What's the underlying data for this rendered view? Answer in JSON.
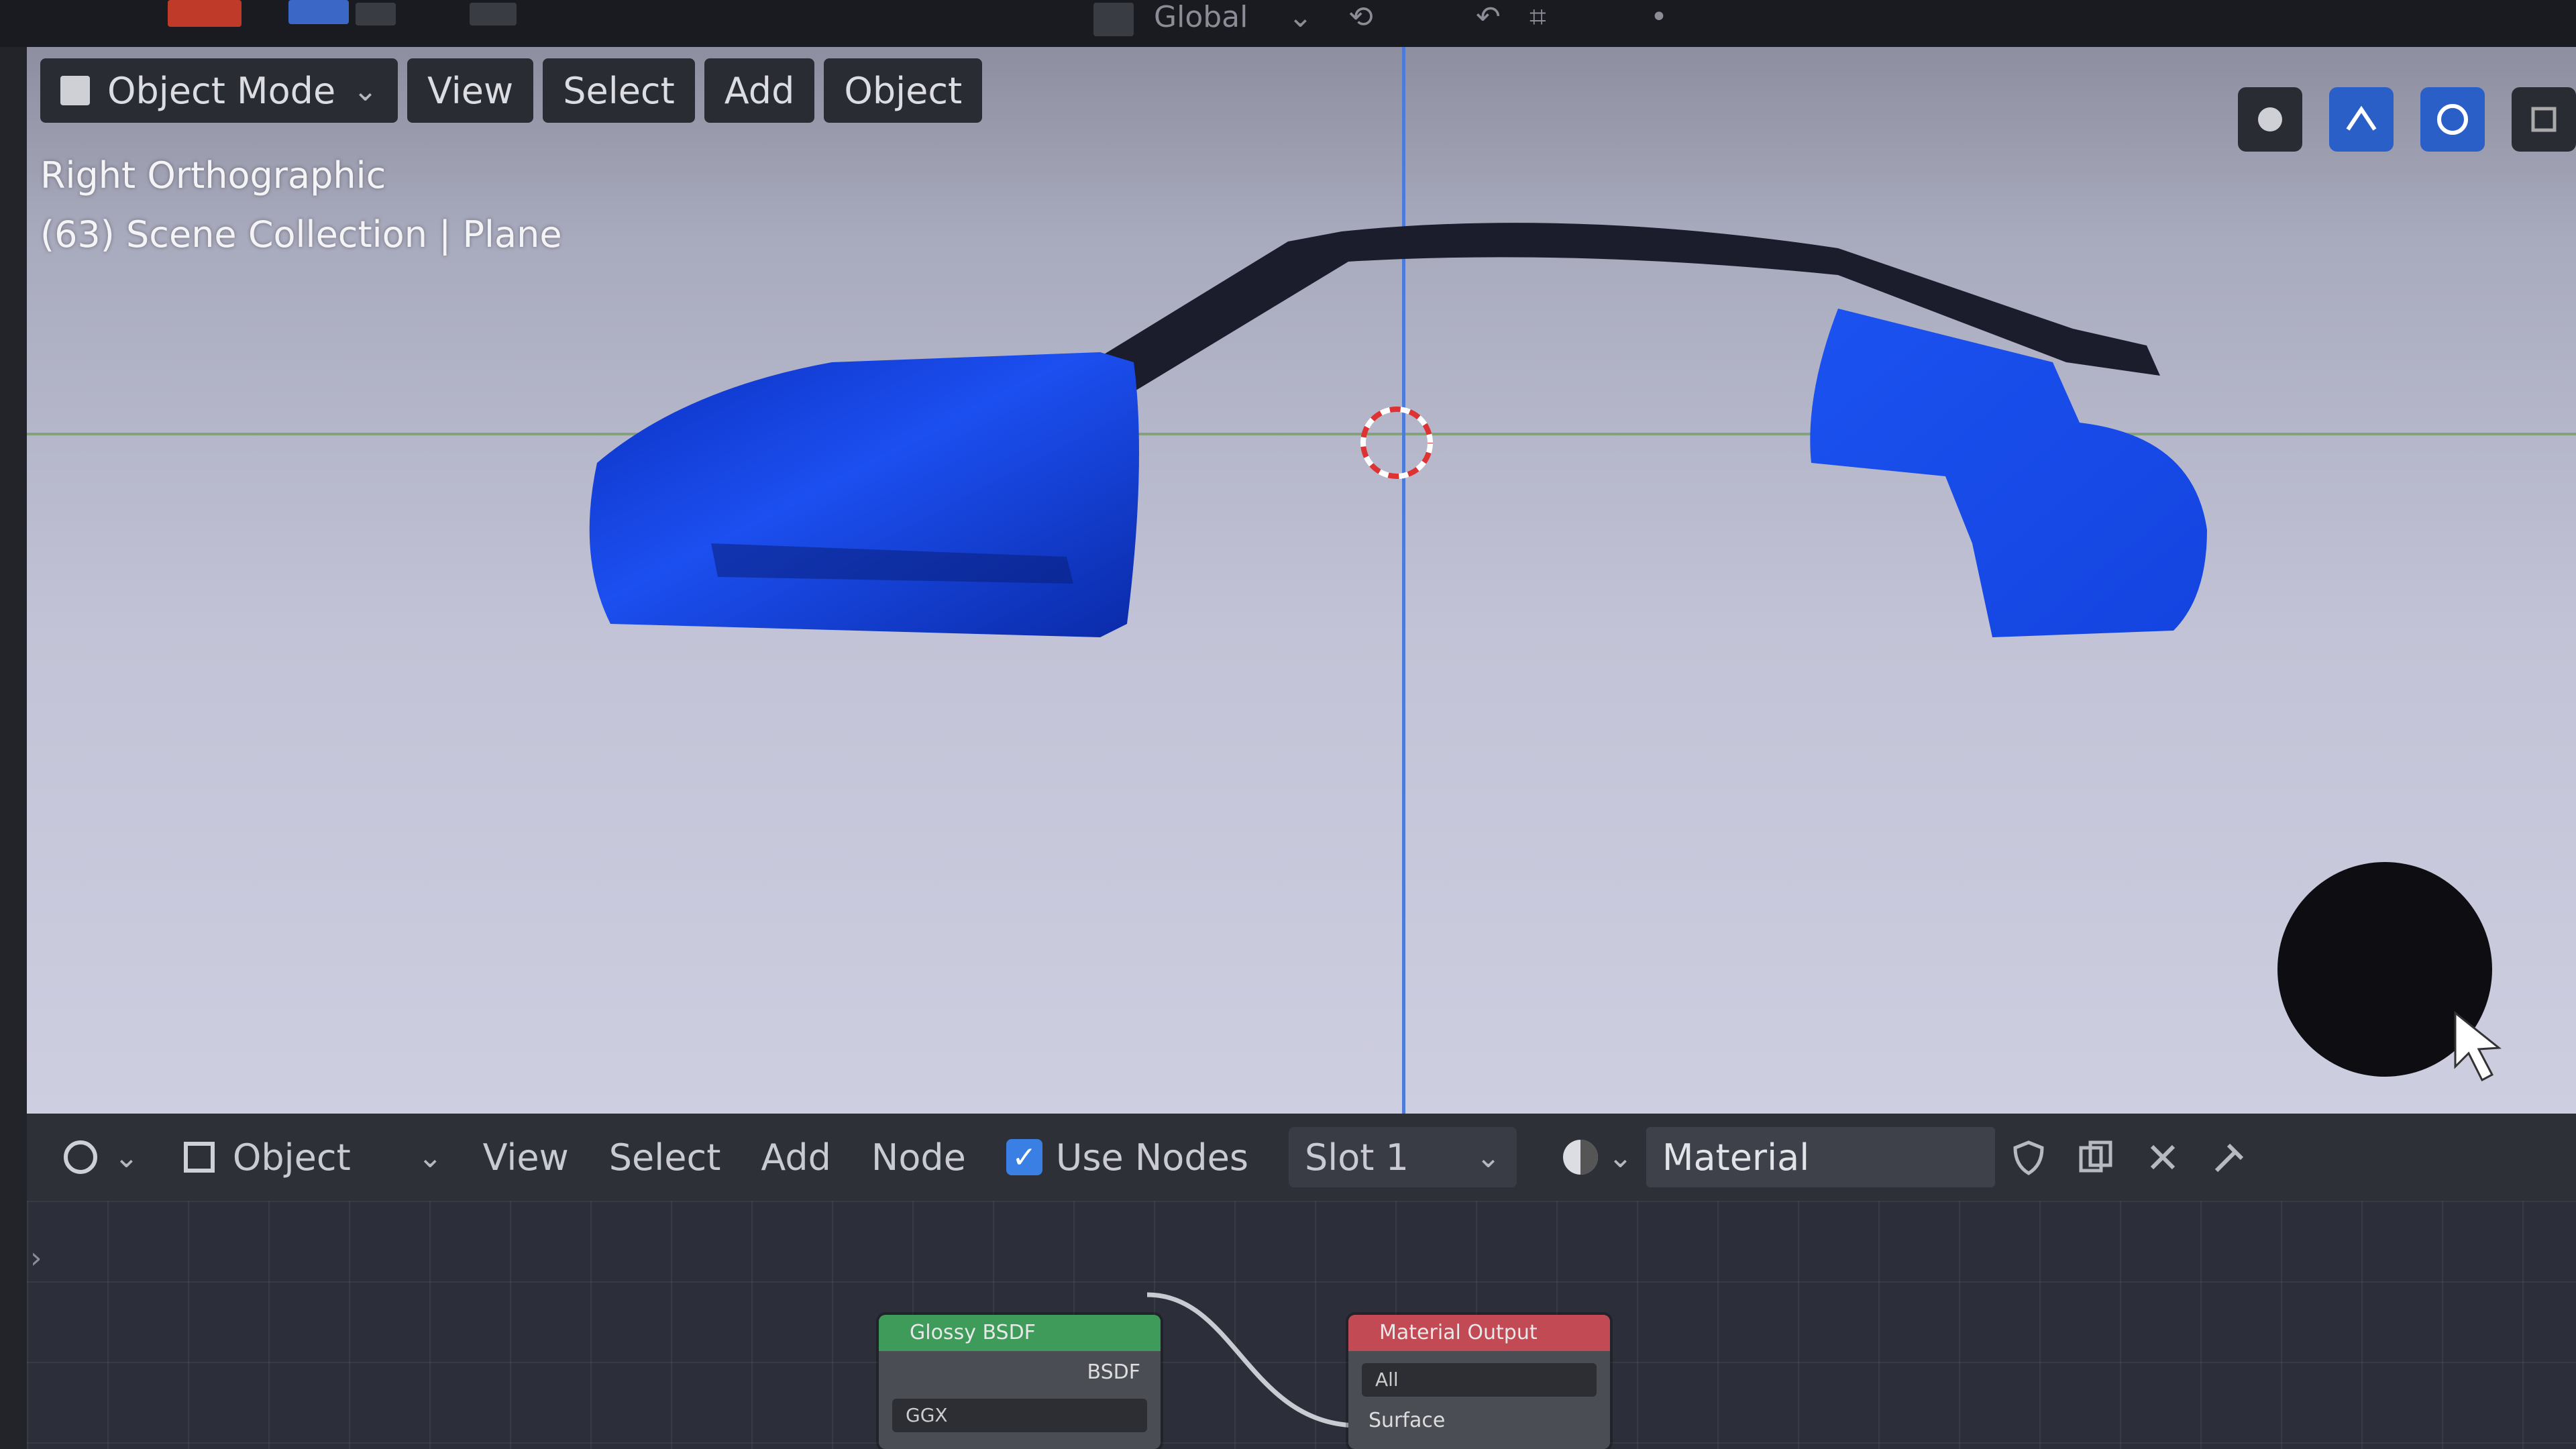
{
  "top_bar": {
    "transform_orientation": "Global"
  },
  "viewport": {
    "header": {
      "mode_label": "Object Mode",
      "menus": [
        "View",
        "Select",
        "Add",
        "Object"
      ]
    },
    "info": {
      "view_name": "Right Orthographic",
      "collection_line": "(63) Scene Collection | Plane"
    },
    "colors": {
      "mesh": "#1a4fe6",
      "background": "#c2c3d6",
      "y_axis": "#4d7bd9",
      "x_axis": "#6d9a5b"
    }
  },
  "node_editor": {
    "header": {
      "context_label": "Object",
      "menus": [
        "View",
        "Select",
        "Add",
        "Node"
      ],
      "use_nodes_label": "Use Nodes",
      "use_nodes_checked": true,
      "slot_label": "Slot 1",
      "material_name": "Material"
    },
    "nodes": {
      "bsdf": {
        "title": "Glossy BSDF",
        "output": "BSDF",
        "distribution": "GGX"
      },
      "output": {
        "title": "Material Output",
        "target": "All",
        "input": "Surface"
      }
    }
  }
}
